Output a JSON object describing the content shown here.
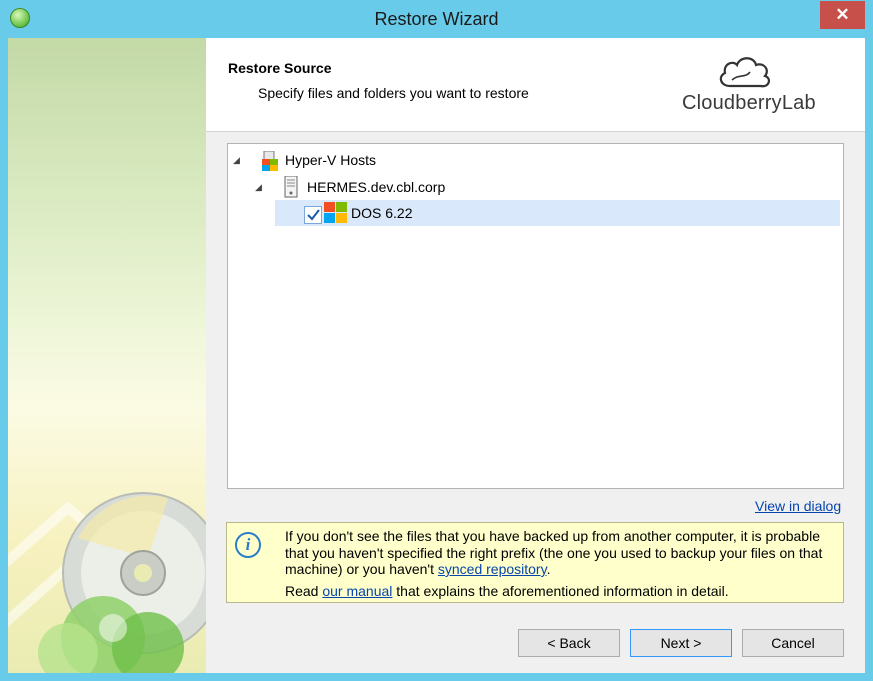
{
  "window": {
    "title": "Restore Wizard"
  },
  "header": {
    "title": "Restore Source",
    "subtitle": "Specify files and folders you want to restore",
    "logo_text": "CloudberryLab"
  },
  "tree": {
    "nodes": [
      {
        "label": "Hyper-V Hosts",
        "expanded": true,
        "icon": "hyperv-hosts-icon"
      },
      {
        "label": "HERMES.dev.cbl.corp",
        "expanded": true,
        "icon": "server-icon"
      },
      {
        "label": "DOS 6.22",
        "checked": true,
        "selected": true,
        "icon": "windows-vm-icon"
      }
    ]
  },
  "view_in_dialog": "View in dialog",
  "info": {
    "line1": "If you don't see the files that you have backed up from another computer, it is probable that you haven't specified the right prefix (the one you used to backup your files on that machine) or you haven't ",
    "link1": "synced repository",
    "line1_end": ".",
    "line2_start": "Read ",
    "link2": "our manual",
    "line2_end": " that explains the aforementioned information in detail."
  },
  "buttons": {
    "back": "< Back",
    "next": "Next >",
    "cancel": "Cancel"
  },
  "colors": {
    "titlebar": "#68cbea",
    "close": "#c7504b",
    "selection": "#d9e8fb",
    "info_bg": "#ffffcc",
    "link": "#0645ad"
  }
}
